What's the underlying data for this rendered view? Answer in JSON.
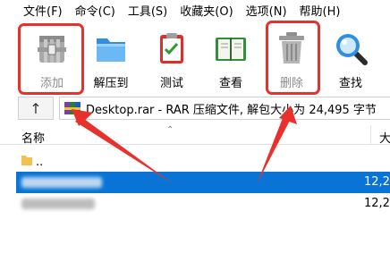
{
  "menu": [
    "文件(F)",
    "命令(C)",
    "工具(S)",
    "收藏夹(O)",
    "选项(N)",
    "帮助(H)"
  ],
  "toolbar": {
    "add_label": "添加",
    "extract_label": "解压到",
    "test_label": "测试",
    "view_label": "查看",
    "delete_label": "删除",
    "find_label": "查找"
  },
  "address": {
    "up_glyph": "↑",
    "text": "Desktop.rar - RAR 压缩文件, 解包大小为 24,495 字节"
  },
  "list": {
    "col_name": "名称",
    "col_size": "大",
    "sort_caret": "⌃",
    "rows": [
      {
        "name": "..",
        "size": ""
      },
      {
        "name": "",
        "size": "12,2"
      },
      {
        "name": "",
        "size": "12,2"
      }
    ]
  },
  "colors": {
    "highlight": "#e8312d",
    "selection": "#0a74d6"
  }
}
